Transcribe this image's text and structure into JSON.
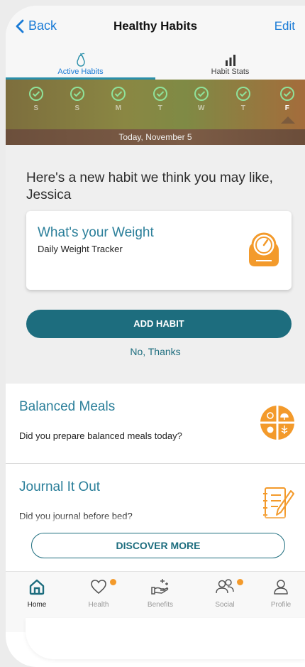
{
  "header": {
    "back_label": "Back",
    "title": "Healthy Habits",
    "edit_label": "Edit"
  },
  "tabs": [
    {
      "label": "Active Habits",
      "icon": "pear-icon",
      "active": true
    },
    {
      "label": "Habit Stats",
      "icon": "bar-chart-icon",
      "active": false
    }
  ],
  "week": {
    "days": [
      "S",
      "S",
      "M",
      "T",
      "W",
      "T",
      "F"
    ],
    "today_index": 6,
    "date_label": "Today, November 5"
  },
  "suggestion": {
    "heading": "Here's a new habit we think you may like, Jessica",
    "card_title": "What's your Weight",
    "card_subtitle": "Daily Weight Tracker",
    "add_label": "ADD HABIT",
    "decline_label": "No, Thanks"
  },
  "habits": [
    {
      "title": "Balanced Meals",
      "question": "Did you prepare balanced meals today?",
      "icon": "plate-icon"
    },
    {
      "title": "Journal It Out",
      "question": "Did you journal before bed?",
      "icon": "journal-icon"
    }
  ],
  "discover_label": "DISCOVER MORE",
  "tabbar": [
    {
      "label": "Home",
      "icon": "home-icon",
      "active": true,
      "badge": false
    },
    {
      "label": "Health",
      "icon": "heart-icon",
      "active": false,
      "badge": true
    },
    {
      "label": "Benefits",
      "icon": "hand-sparkle-icon",
      "active": false,
      "badge": false
    },
    {
      "label": "Social",
      "icon": "people-icon",
      "active": false,
      "badge": true
    },
    {
      "label": "Profile",
      "icon": "person-icon",
      "active": false,
      "badge": false
    }
  ],
  "colors": {
    "accent": "#1d6d7e",
    "link": "#1a7bd6",
    "orange": "#f39a2b",
    "check": "#8fe29a"
  }
}
